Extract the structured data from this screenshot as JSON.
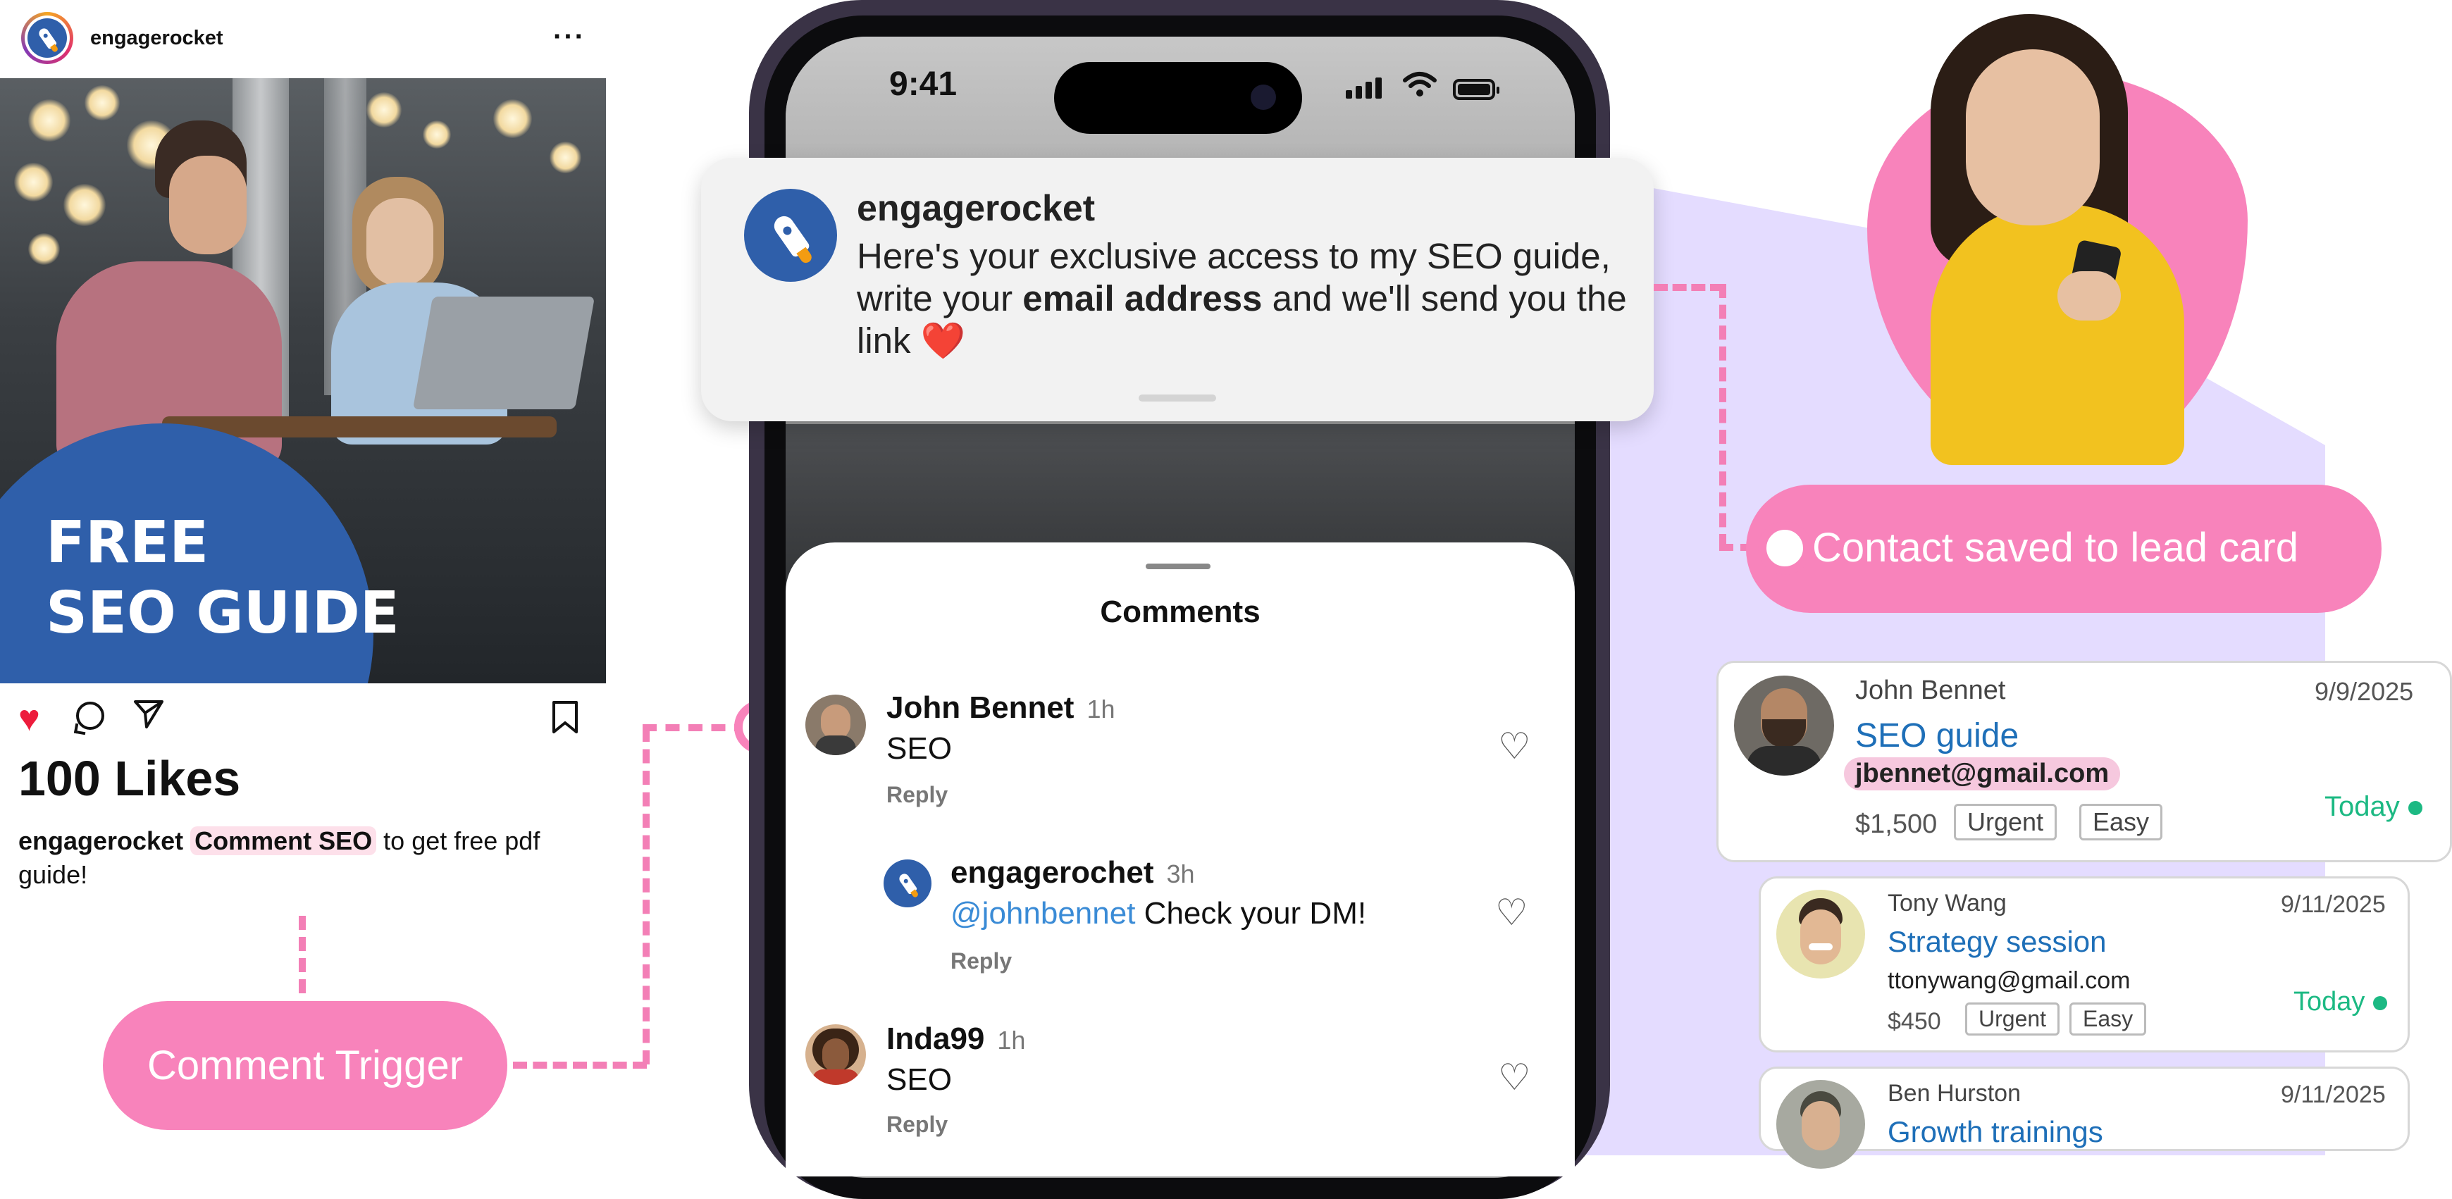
{
  "post": {
    "username": "engagerocket",
    "more_icon": "more-dots-icon",
    "banner_line1": "FREE",
    "banner_line2": "SEO GUIDE",
    "likes": "100 Likes",
    "caption_user": "engagerocket",
    "caption_highlight": "Comment SEO",
    "caption_rest": "to get free pdf guide!"
  },
  "trigger": {
    "label": "Comment Trigger"
  },
  "phone": {
    "time": "9:41",
    "notification": {
      "app": "engagerocket",
      "body_part1": "Here's your exclusive access to my SEO guide, write your ",
      "body_bold": "email address",
      "body_part2": " and we'll send you the link ❤️"
    },
    "comments_title": "Comments",
    "comments": [
      {
        "name": "John Bennet",
        "time": "1h",
        "text": "SEO",
        "reply": "Reply"
      },
      {
        "name": "engagerochet",
        "time": "3h",
        "mention": "@johnbennet",
        "text": " Check your DM!",
        "reply": "Reply"
      },
      {
        "name": "Inda99",
        "time": "1h",
        "text": "SEO",
        "reply": "Reply"
      }
    ]
  },
  "saved": {
    "label": "Contact saved to lead card"
  },
  "leads": [
    {
      "name": "John Bennet",
      "date": "9/9/2025",
      "deal": "SEO guide",
      "email": "jbennet@gmail.com",
      "amount": "$1,500",
      "tags": [
        "Urgent",
        "Easy"
      ],
      "due": "Today"
    },
    {
      "name": "Tony Wang",
      "date": "9/11/2025",
      "deal": "Strategy session",
      "email": "ttonywang@gmail.com",
      "amount": "$450",
      "tags": [
        "Urgent",
        "Easy"
      ],
      "due": "Today"
    },
    {
      "name": "Ben Hurston",
      "date": "9/11/2025",
      "deal": "Growth trainings"
    }
  ],
  "colors": {
    "brand_blue": "#2f5faa",
    "pink": "#f883bb",
    "green": "#1cb983",
    "lavender": "#e4dcff"
  }
}
